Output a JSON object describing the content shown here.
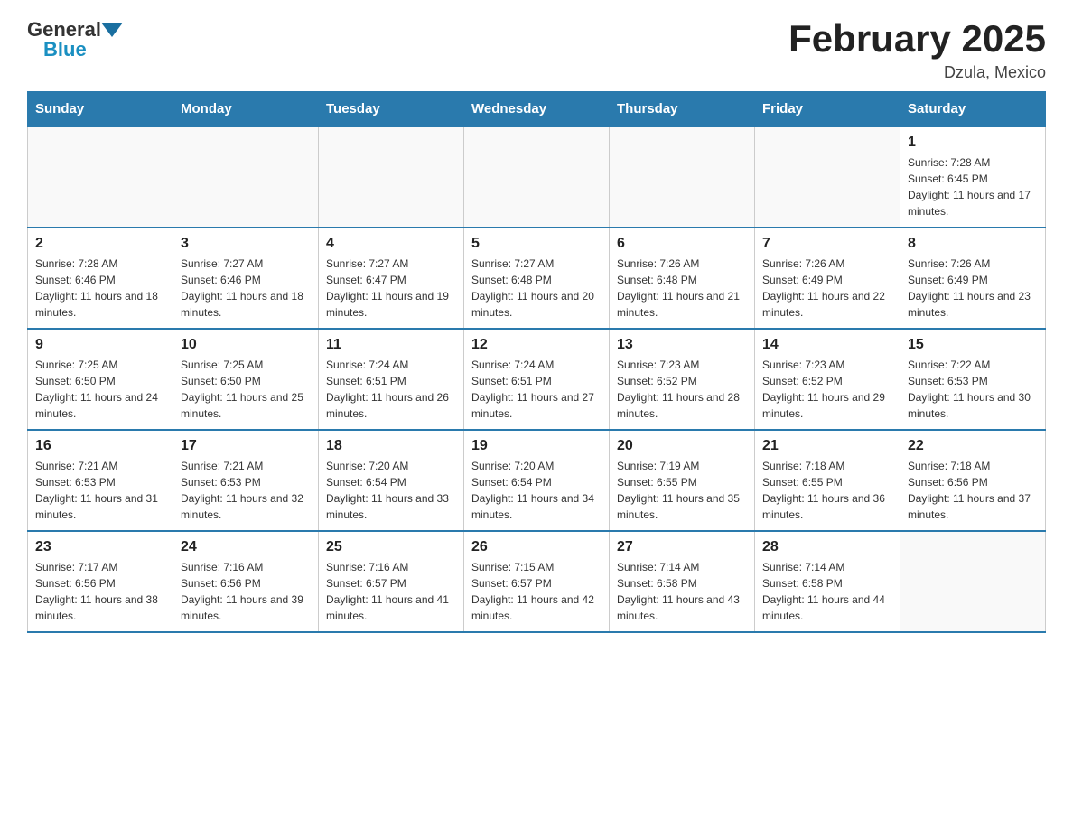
{
  "header": {
    "logo_general": "General",
    "logo_blue": "Blue",
    "month_title": "February 2025",
    "location": "Dzula, Mexico"
  },
  "weekdays": [
    "Sunday",
    "Monday",
    "Tuesday",
    "Wednesday",
    "Thursday",
    "Friday",
    "Saturday"
  ],
  "weeks": [
    [
      {
        "day": "",
        "info": ""
      },
      {
        "day": "",
        "info": ""
      },
      {
        "day": "",
        "info": ""
      },
      {
        "day": "",
        "info": ""
      },
      {
        "day": "",
        "info": ""
      },
      {
        "day": "",
        "info": ""
      },
      {
        "day": "1",
        "info": "Sunrise: 7:28 AM\nSunset: 6:45 PM\nDaylight: 11 hours and 17 minutes."
      }
    ],
    [
      {
        "day": "2",
        "info": "Sunrise: 7:28 AM\nSunset: 6:46 PM\nDaylight: 11 hours and 18 minutes."
      },
      {
        "day": "3",
        "info": "Sunrise: 7:27 AM\nSunset: 6:46 PM\nDaylight: 11 hours and 18 minutes."
      },
      {
        "day": "4",
        "info": "Sunrise: 7:27 AM\nSunset: 6:47 PM\nDaylight: 11 hours and 19 minutes."
      },
      {
        "day": "5",
        "info": "Sunrise: 7:27 AM\nSunset: 6:48 PM\nDaylight: 11 hours and 20 minutes."
      },
      {
        "day": "6",
        "info": "Sunrise: 7:26 AM\nSunset: 6:48 PM\nDaylight: 11 hours and 21 minutes."
      },
      {
        "day": "7",
        "info": "Sunrise: 7:26 AM\nSunset: 6:49 PM\nDaylight: 11 hours and 22 minutes."
      },
      {
        "day": "8",
        "info": "Sunrise: 7:26 AM\nSunset: 6:49 PM\nDaylight: 11 hours and 23 minutes."
      }
    ],
    [
      {
        "day": "9",
        "info": "Sunrise: 7:25 AM\nSunset: 6:50 PM\nDaylight: 11 hours and 24 minutes."
      },
      {
        "day": "10",
        "info": "Sunrise: 7:25 AM\nSunset: 6:50 PM\nDaylight: 11 hours and 25 minutes."
      },
      {
        "day": "11",
        "info": "Sunrise: 7:24 AM\nSunset: 6:51 PM\nDaylight: 11 hours and 26 minutes."
      },
      {
        "day": "12",
        "info": "Sunrise: 7:24 AM\nSunset: 6:51 PM\nDaylight: 11 hours and 27 minutes."
      },
      {
        "day": "13",
        "info": "Sunrise: 7:23 AM\nSunset: 6:52 PM\nDaylight: 11 hours and 28 minutes."
      },
      {
        "day": "14",
        "info": "Sunrise: 7:23 AM\nSunset: 6:52 PM\nDaylight: 11 hours and 29 minutes."
      },
      {
        "day": "15",
        "info": "Sunrise: 7:22 AM\nSunset: 6:53 PM\nDaylight: 11 hours and 30 minutes."
      }
    ],
    [
      {
        "day": "16",
        "info": "Sunrise: 7:21 AM\nSunset: 6:53 PM\nDaylight: 11 hours and 31 minutes."
      },
      {
        "day": "17",
        "info": "Sunrise: 7:21 AM\nSunset: 6:53 PM\nDaylight: 11 hours and 32 minutes."
      },
      {
        "day": "18",
        "info": "Sunrise: 7:20 AM\nSunset: 6:54 PM\nDaylight: 11 hours and 33 minutes."
      },
      {
        "day": "19",
        "info": "Sunrise: 7:20 AM\nSunset: 6:54 PM\nDaylight: 11 hours and 34 minutes."
      },
      {
        "day": "20",
        "info": "Sunrise: 7:19 AM\nSunset: 6:55 PM\nDaylight: 11 hours and 35 minutes."
      },
      {
        "day": "21",
        "info": "Sunrise: 7:18 AM\nSunset: 6:55 PM\nDaylight: 11 hours and 36 minutes."
      },
      {
        "day": "22",
        "info": "Sunrise: 7:18 AM\nSunset: 6:56 PM\nDaylight: 11 hours and 37 minutes."
      }
    ],
    [
      {
        "day": "23",
        "info": "Sunrise: 7:17 AM\nSunset: 6:56 PM\nDaylight: 11 hours and 38 minutes."
      },
      {
        "day": "24",
        "info": "Sunrise: 7:16 AM\nSunset: 6:56 PM\nDaylight: 11 hours and 39 minutes."
      },
      {
        "day": "25",
        "info": "Sunrise: 7:16 AM\nSunset: 6:57 PM\nDaylight: 11 hours and 41 minutes."
      },
      {
        "day": "26",
        "info": "Sunrise: 7:15 AM\nSunset: 6:57 PM\nDaylight: 11 hours and 42 minutes."
      },
      {
        "day": "27",
        "info": "Sunrise: 7:14 AM\nSunset: 6:58 PM\nDaylight: 11 hours and 43 minutes."
      },
      {
        "day": "28",
        "info": "Sunrise: 7:14 AM\nSunset: 6:58 PM\nDaylight: 11 hours and 44 minutes."
      },
      {
        "day": "",
        "info": ""
      }
    ]
  ]
}
